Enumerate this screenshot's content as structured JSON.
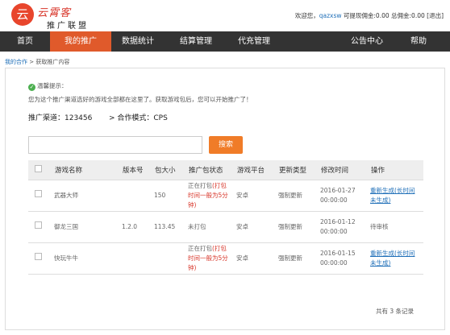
{
  "header": {
    "logo_mark": "云",
    "logo_title": "云霄客",
    "logo_sub": "推广联盟",
    "welcome": "欢迎您，",
    "username": "qazxsw",
    "balance": "可提现佣金:0.00 总佣金:0.00",
    "logout": "[退出]"
  },
  "nav": {
    "items": [
      {
        "label": "首页"
      },
      {
        "label": "我的推广"
      },
      {
        "label": "数据统计"
      },
      {
        "label": "结算管理"
      },
      {
        "label": "代充管理"
      },
      {
        "label": "公告中心"
      },
      {
        "label": "帮助"
      }
    ]
  },
  "breadcrumb": {
    "link": "我的合作",
    "sep": " > ",
    "current": "获取推广内容"
  },
  "tip": {
    "title": "温馨提示：",
    "body": "您为这个推广渠道选好的游戏全部都在这里了。获取游戏包后，您可以开始推广了！"
  },
  "info": {
    "channel": "推广渠道：123456",
    "mode": "> 合作模式：CPS"
  },
  "search": {
    "placeholder": "",
    "button": "搜索"
  },
  "table": {
    "columns": [
      "游戏名称",
      "版本号",
      "包大小",
      "推广包状态",
      "游戏平台",
      "更新类型",
      "修改时间",
      "操作"
    ],
    "rows": [
      {
        "name": "武器大师",
        "version": "",
        "size": "150",
        "status_a": "正在打包",
        "status_b": "(打包时间一般为5分钟)",
        "platform": "安卓",
        "update": "强制更新",
        "date": "2016-01-27",
        "time": "00:00:00",
        "action": "重新生成(长时间未生成)"
      },
      {
        "name": "御龙三国",
        "version": "1.2.0",
        "size": "113.45",
        "status_a": "未打包",
        "status_b": "",
        "platform": "安卓",
        "update": "强制更新",
        "date": "2016-01-12",
        "time": "00:00:00",
        "action": "待审核"
      },
      {
        "name": "快玩牛牛",
        "version": "",
        "size": "",
        "status_a": "正在打包",
        "status_b": "(打包时间一般为5分钟)",
        "platform": "安卓",
        "update": "强制更新",
        "date": "2016-01-15",
        "time": "00:00:00",
        "action": "重新生成(长时间未生成)"
      }
    ]
  },
  "footer": {
    "count": "共有 3 条记录"
  }
}
